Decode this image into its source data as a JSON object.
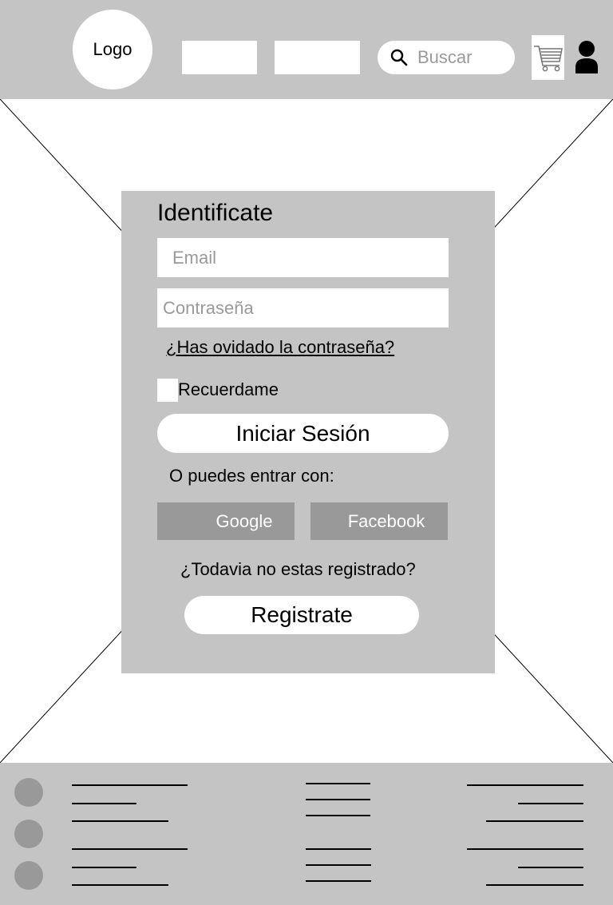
{
  "header": {
    "logo_label": "Logo",
    "search_placeholder": "Buscar",
    "icons": {
      "search": "search-icon",
      "cart": "cart-icon",
      "user": "user-icon"
    }
  },
  "login": {
    "title": "Identificate",
    "email_placeholder": "Email",
    "password_placeholder": "Contraseña",
    "forgot_link": "¿Has ovidado la contraseña?",
    "remember_label": "Recuerdame",
    "login_button": "Iniciar Sesión",
    "alt_login_text": "O puedes entrar con:",
    "google_button": "Google",
    "facebook_button": "Facebook",
    "not_registered_text": "¿Todavia no estas registrado?",
    "register_button": "Registrate"
  },
  "colors": {
    "panel": "#c4c4c4",
    "social_button": "#999999",
    "placeholder": "#9a9a9a"
  }
}
